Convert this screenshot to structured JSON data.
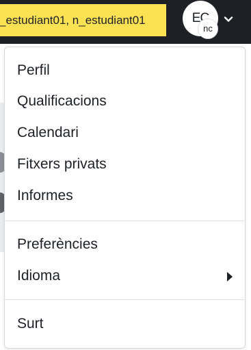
{
  "navbar": {
    "loggedin_as": "_estudiant01, n_estudiant01",
    "avatar_initials": "EC",
    "avatar_badge": "nc"
  },
  "user_menu": {
    "items": [
      {
        "label": "Perfil"
      },
      {
        "label": "Qualificacions"
      },
      {
        "label": "Calendari"
      },
      {
        "label": "Fitxers privats"
      },
      {
        "label": "Informes"
      },
      {
        "label": "Preferències"
      },
      {
        "label": "Idioma"
      },
      {
        "label": "Surt"
      }
    ]
  },
  "colors": {
    "navbar_bg": "#1d2125",
    "badge_bg": "#fce253",
    "menu_border": "#d6d9dc"
  }
}
